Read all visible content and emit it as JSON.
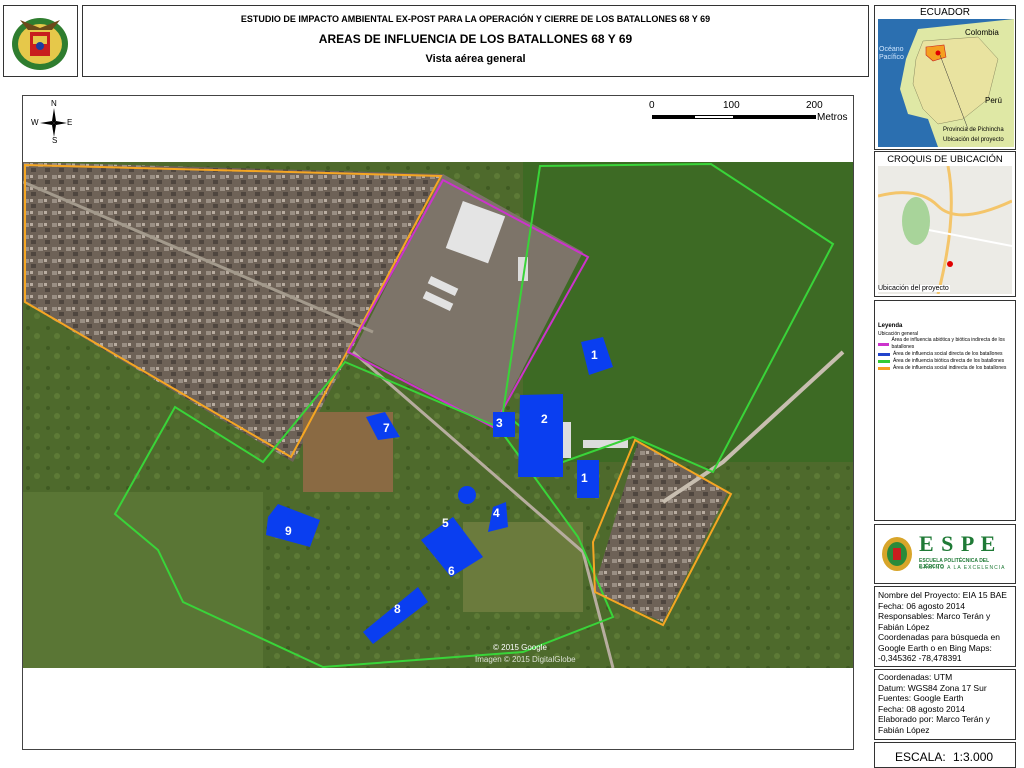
{
  "header": {
    "line1": "ESTUDIO DE IMPACTO AMBIENTAL EX-POST PARA LA OPERACIÓN Y CIERRE DE LOS BATALLONES 68 Y 69",
    "line2": "AREAS DE INFLUENCIA DE LOS BATALLONES 68 Y 69",
    "line3": "Vista aérea general"
  },
  "map": {
    "compass": {
      "n": "N",
      "s": "S",
      "e": "E",
      "w": "W"
    },
    "scalebar": {
      "t0": "0",
      "t1": "100",
      "t2": "200",
      "unit": "Metros"
    },
    "watermark1": "© 2015 Google",
    "watermark2": "Imagen © 2015 DigitalGlobe",
    "building_labels": [
      "1",
      "1",
      "2",
      "3",
      "4",
      "5",
      "6",
      "7",
      "8",
      "9"
    ]
  },
  "location_map": {
    "title": "ECUADOR",
    "colombia": "Colombia",
    "ocean": "Océano Pacífico",
    "peru": "Perú",
    "note1": "Provincia de Pichincha",
    "note2": "Ubicación del proyecto"
  },
  "croquis": {
    "title": "CROQUIS DE UBICACIÓN",
    "caption": "Ubicación del proyecto"
  },
  "legend": {
    "title": "Leyenda",
    "subtitle": "Ubicación general",
    "items": [
      {
        "label": "Área de influencia abiótica y biótica indirecta de los batallones",
        "color": "#cc33cc"
      },
      {
        "label": "Área de influencia social directa de los batallones",
        "color": "#2244cc"
      },
      {
        "label": "Área de influencia biótica directa de los batallones",
        "color": "#33cc33"
      },
      {
        "label": "Área de influencia social indirecta de los batallones",
        "color": "#f5a020"
      }
    ]
  },
  "logo": {
    "name": "E S P E",
    "sub1": "ESCUELA POLITÉCNICA DEL EJÉRCITO",
    "sub2": "CAMINO A LA EXCELENCIA"
  },
  "project": {
    "lines": [
      "Nombre del Proyecto: EIA 15 BAE",
      "Fecha: 06 agosto 2014",
      "Responsables: Marco Terán y",
      "Fabián López",
      "Coordenadas para búsqueda en",
      "Google Earth o en Bing Maps:",
      "-0,345362 -78,478391"
    ]
  },
  "coords": {
    "lines": [
      "Coordenadas: UTM",
      "Datum: WGS84 Zona 17 Sur",
      "Fuentes: Google Earth",
      "Fecha: 08 agosto 2014",
      "Elaborado por: Marco Terán y",
      "Fabián López"
    ]
  },
  "scale": {
    "label": "ESCALA:",
    "value": "1:3.000"
  },
  "colors": {
    "magenta": "#cc33cc",
    "green": "#39d439",
    "orange": "#f5a623",
    "building": "#0a3ef0"
  }
}
